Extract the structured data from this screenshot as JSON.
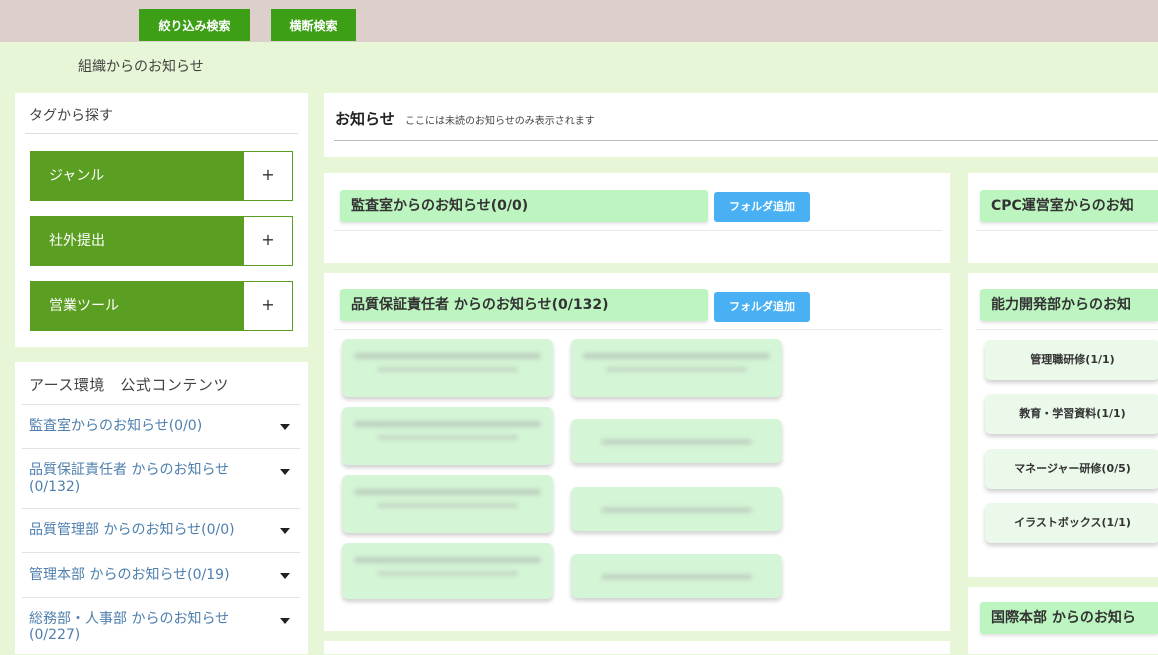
{
  "toolbar": {
    "filter_search_label": "絞り込み検索",
    "cross_search_label": "横断検索"
  },
  "org_title": "組織からのお知らせ",
  "tag_panel": {
    "title": "タグから探す",
    "items": [
      {
        "label": "ジャンル",
        "action": "+"
      },
      {
        "label": "社外提出",
        "action": "+"
      },
      {
        "label": "営業ツール",
        "action": "+"
      }
    ]
  },
  "nav_panel": {
    "title": "アース環境　公式コンテンツ",
    "items": [
      {
        "label": "監査室からのお知らせ(0/0)"
      },
      {
        "label": "品質保証責任者 からのお知らせ",
        "label2": "(0/132)"
      },
      {
        "label": "品質管理部 からのお知らせ(0/0)"
      },
      {
        "label": "管理本部 からのお知らせ(0/19)"
      },
      {
        "label": "総務部・人事部 からのお知らせ",
        "label2": "(0/227)"
      }
    ]
  },
  "notice": {
    "title": "お知らせ",
    "subtitle": "ここには未読のお知らせのみ表示されます"
  },
  "cards": {
    "audit": {
      "title": "監査室からのお知らせ(0/0)",
      "button": "フォルダ追加"
    },
    "quality": {
      "title": "品質保証責任者 からのお知らせ(0/132)",
      "button": "フォルダ追加"
    },
    "cpc": {
      "title": "CPC運営室からのお知"
    },
    "ability": {
      "title": "能力開発部からのお知",
      "subfolders": [
        "管理職研修(1/1)",
        "教育・学習資料(1/1)",
        "マネージャー研修(0/5)",
        "イラストボックス(1/1)"
      ]
    },
    "intl": {
      "title": "国際本部 からのお知ら"
    }
  },
  "colors": {
    "page_bg": "#e7f6d6",
    "topbar_bg": "#ddd0cc",
    "toolbar_button": "#3d9f16",
    "tag_green": "#5a9f22",
    "card_head": "#bdf5c0",
    "folder_button": "#48b0f3",
    "nav_link": "#4e7fae"
  }
}
